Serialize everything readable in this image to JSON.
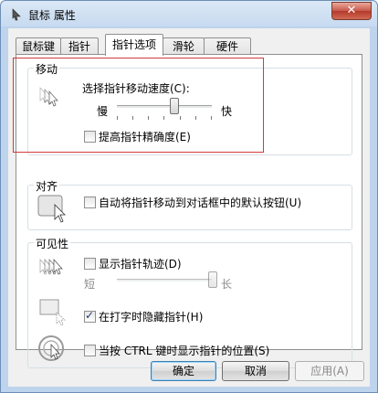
{
  "window": {
    "title": "鼠标 属性",
    "close_glyph": "✕"
  },
  "tabs": [
    {
      "label": "鼠标键"
    },
    {
      "label": "指针"
    },
    {
      "label": "指针选项"
    },
    {
      "label": "滑轮"
    },
    {
      "label": "硬件"
    }
  ],
  "motion": {
    "group_label": "移动",
    "speed_label": "选择指针移动速度(C):",
    "slow_label": "慢",
    "fast_label": "快",
    "speed_level": 0.6,
    "precision_label": "提高指针精确度(E)",
    "precision_checked": false
  },
  "snap": {
    "group_label": "对齐",
    "label": "自动将指针移动到对话框中的默认按钮(U)",
    "checked": false
  },
  "visibility": {
    "group_label": "可见性",
    "trails_label": "显示指针轨迹(D)",
    "trails_checked": false,
    "short_label": "短",
    "long_label": "长",
    "trail_level": 1.0,
    "hide_label": "在打字时隐藏指针(H)",
    "hide_checked": true,
    "ctrl_label": "当按 CTRL 键时显示指针的位置(S)",
    "ctrl_checked": false
  },
  "buttons": {
    "ok": "确定",
    "cancel": "取消",
    "apply": "应用(A)"
  }
}
